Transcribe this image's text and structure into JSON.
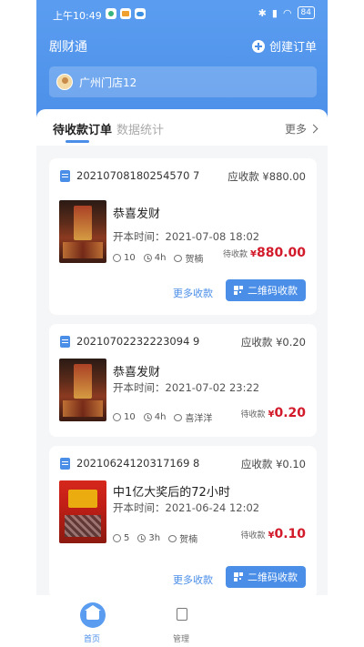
{
  "status_bar": {
    "time": "上午10:49",
    "battery": "84"
  },
  "header": {
    "app_title": "剧财通",
    "create_order": "创建订单",
    "store": "广州门店12"
  },
  "tabs": [
    {
      "label": "待收款订单"
    },
    {
      "label": "数据统计"
    }
  ],
  "more": "更多",
  "orders": [
    {
      "order_no": "20210708180254570 7",
      "receivable": "应收款 ¥880.00",
      "title": "恭喜发财",
      "open_time": "开本时间：2021-07-08 18:02",
      "players": "10",
      "duration": "4h",
      "host": "贺楠",
      "pending_label": "待收款",
      "pending_amount": "880.00",
      "more_collect": "更多收款",
      "qr_collect": "二维码收款"
    },
    {
      "order_no": "20210702232223094 9",
      "receivable": "应收款 ¥0.20",
      "title": "恭喜发财",
      "open_time": "开本时间：2021-07-02 23:22",
      "players": "10",
      "duration": "4h",
      "host": "喜洋洋",
      "pending_label": "待收款",
      "pending_amount": "0.20"
    },
    {
      "order_no": "20210624120317169 8",
      "receivable": "应收款 ¥0.10",
      "title": "中1亿大奖后的72小时",
      "open_time": "开本时间：2021-06-24 12:02",
      "players": "5",
      "duration": "3h",
      "host": "贺楠",
      "pending_label": "待收款",
      "pending_amount": "0.10",
      "more_collect": "更多收款",
      "qr_collect": "二维码收款"
    }
  ],
  "currency_symbol": "¥",
  "bottom_nav": {
    "home": "首页",
    "manage": "管理"
  }
}
